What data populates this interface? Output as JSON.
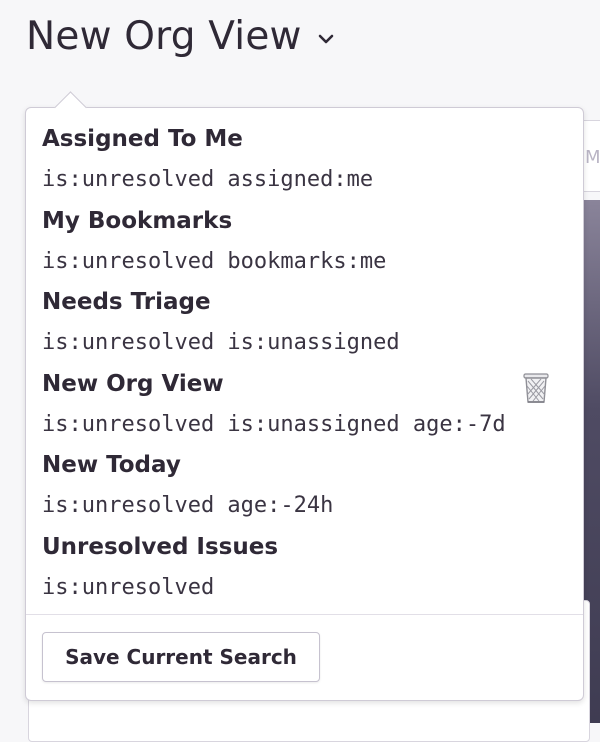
{
  "header": {
    "title": "New Org View",
    "chevron_icon": "chevron-down-icon"
  },
  "saved_searches": [
    {
      "name": "Assigned To Me",
      "query": "is:unresolved assigned:me"
    },
    {
      "name": "My Bookmarks",
      "query": "is:unresolved bookmarks:me"
    },
    {
      "name": "Needs Triage",
      "query": "is:unresolved is:unassigned"
    },
    {
      "name": "New Org View",
      "query": "is:unresolved is:unassigned age:-7d",
      "delete_icon": "trash-icon"
    },
    {
      "name": "New Today",
      "query": "is:unresolved age:-24h"
    },
    {
      "name": "Unresolved Issues",
      "query": "is:unresolved"
    }
  ],
  "footer": {
    "save_label": "Save Current Search"
  },
  "background": {
    "partial_text": "M"
  },
  "colors": {
    "text": "#2f2936",
    "border": "#cfcbd6",
    "sidebar_accent": "#4f4b63"
  }
}
